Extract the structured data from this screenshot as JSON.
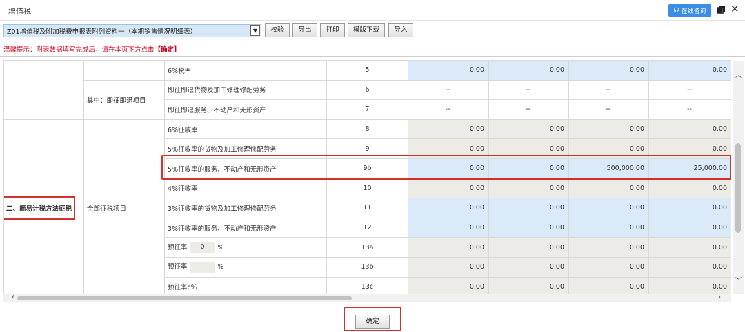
{
  "window": {
    "title": "增值税",
    "consult_label": "在线咨询"
  },
  "toolbar": {
    "select_value": "Z01增值税及附加税费申报表附列资料一（本期销售情况明细表）",
    "buttons": [
      "校验",
      "导出",
      "打印",
      "模版下载",
      "导入"
    ]
  },
  "hint": {
    "prefix": "温馨提示：附表数据填写完成后，请在本页下方点击",
    "confirm_word": "【确定】"
  },
  "section": {
    "simple_tax": "二、简易计税方法征税",
    "all_items": "全部征税项目",
    "immediate": "其中：即征即退项目"
  },
  "rows": [
    {
      "label": "6%税率",
      "line": "5",
      "values": [
        "0.00",
        "0.00",
        "0.00",
        "0.00"
      ],
      "style": "blue"
    },
    {
      "label": "即征即退货物及加工修理修配劳务",
      "line": "6",
      "values": [
        "--",
        "--",
        "--",
        "--"
      ],
      "style": "white"
    },
    {
      "label": "即征即退服务、不动产和无形资产",
      "line": "7",
      "values": [
        "--",
        "--",
        "--",
        "--"
      ],
      "style": "white"
    },
    {
      "label": "6%征收率",
      "line": "8",
      "values": [
        "0.00",
        "0.00",
        "0.00",
        "0.00"
      ],
      "style": "gray"
    },
    {
      "label": "5%征收率的货物及加工修理修配劳务",
      "line": "9",
      "values": [
        "0.00",
        "0.00",
        "0.00",
        "0.00"
      ],
      "style": "gray"
    },
    {
      "label": "5%征收率的服务、不动产和无形资产",
      "line": "9b",
      "values": [
        "0.00",
        "0.00",
        "500,000.00",
        "25,000.00"
      ],
      "style": "blue"
    },
    {
      "label": "4%征收率",
      "line": "10",
      "values": [
        "0.00",
        "0.00",
        "0.00",
        "0.00"
      ],
      "style": "gray"
    },
    {
      "label": "3%征收率的货物及加工修理修配劳务",
      "line": "11",
      "values": [
        "0.00",
        "0.00",
        "0.00",
        "0.00"
      ],
      "style": "blue"
    },
    {
      "label": "3%征收率的服务、不动产和无形资产",
      "line": "12",
      "values": [
        "0.00",
        "0.00",
        "0.00",
        "0.00"
      ],
      "style": "blue"
    },
    {
      "label": "预征率",
      "rate": "0",
      "unit": "%",
      "line": "13a",
      "values": [
        "0.00",
        "0.00",
        "0.00",
        "0.00"
      ],
      "style": "gray"
    },
    {
      "label": "预征率",
      "rate": "",
      "unit": "%",
      "line": "13b",
      "values": [
        "0.00",
        "0.00",
        "0.00",
        "0.00"
      ],
      "style": "gray"
    },
    {
      "label": "预征率c%",
      "line": "13c",
      "values": [
        "0.00",
        "0.00",
        "0.00",
        "0.00"
      ],
      "style": "gray"
    }
  ],
  "confirm_label": "确定",
  "colors": {
    "accent_blue": "#3a8ee6",
    "highlight_red": "#d0312d",
    "editable_blue": "#dbeaf8",
    "readonly_gray": "#ecebe5"
  }
}
